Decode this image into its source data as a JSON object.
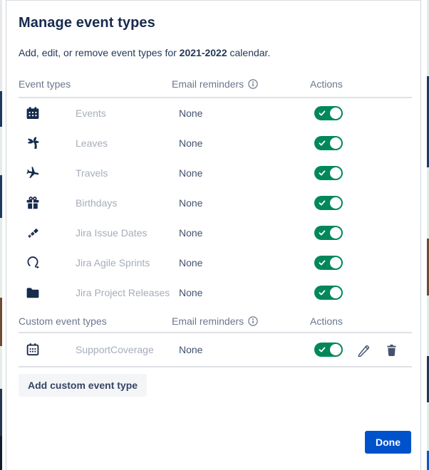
{
  "dialog": {
    "title": "Manage event types",
    "subtitle_prefix": "Add, edit, or remove event types for ",
    "subtitle_bold": "2021-2022",
    "subtitle_suffix": " calendar."
  },
  "standard_section": {
    "header": {
      "event_types": "Event types",
      "email_reminders": "Email reminders",
      "actions": "Actions"
    },
    "rows": [
      {
        "icon": "calendar-icon",
        "label": "Events",
        "email_reminder": "None",
        "enabled": true
      },
      {
        "icon": "palm-tree-icon",
        "label": "Leaves",
        "email_reminder": "None",
        "enabled": true
      },
      {
        "icon": "airplane-icon",
        "label": "Travels",
        "email_reminder": "None",
        "enabled": true
      },
      {
        "icon": "gift-icon",
        "label": "Birthdays",
        "email_reminder": "None",
        "enabled": true
      },
      {
        "icon": "jira-logo-icon",
        "label": "Jira Issue Dates",
        "email_reminder": "None",
        "enabled": true
      },
      {
        "icon": "sprint-loop-icon",
        "label": "Jira Agile Sprints",
        "email_reminder": "None",
        "enabled": true
      },
      {
        "icon": "folder-icon",
        "label": "Jira Project Releases",
        "email_reminder": "None",
        "enabled": true
      }
    ]
  },
  "custom_section": {
    "header": {
      "custom_event_types": "Custom event types",
      "email_reminders": "Email reminders",
      "actions": "Actions"
    },
    "rows": [
      {
        "icon": "calendar-outline-icon",
        "label": "SupportCoverage",
        "email_reminder": "None",
        "enabled": true
      }
    ]
  },
  "buttons": {
    "add_custom": "Add custom event type",
    "done": "Done"
  },
  "colors": {
    "toggle_on": "#00875A",
    "primary_button": "#0052CC",
    "icon_navy": "#172B4D",
    "action_icon": "#44526b",
    "header_text": "#6B778C",
    "row_label": "#A5ADBA",
    "value_text": "#42526E",
    "divider": "#DFE1E6",
    "add_button_bg": "#F4F5F7"
  }
}
